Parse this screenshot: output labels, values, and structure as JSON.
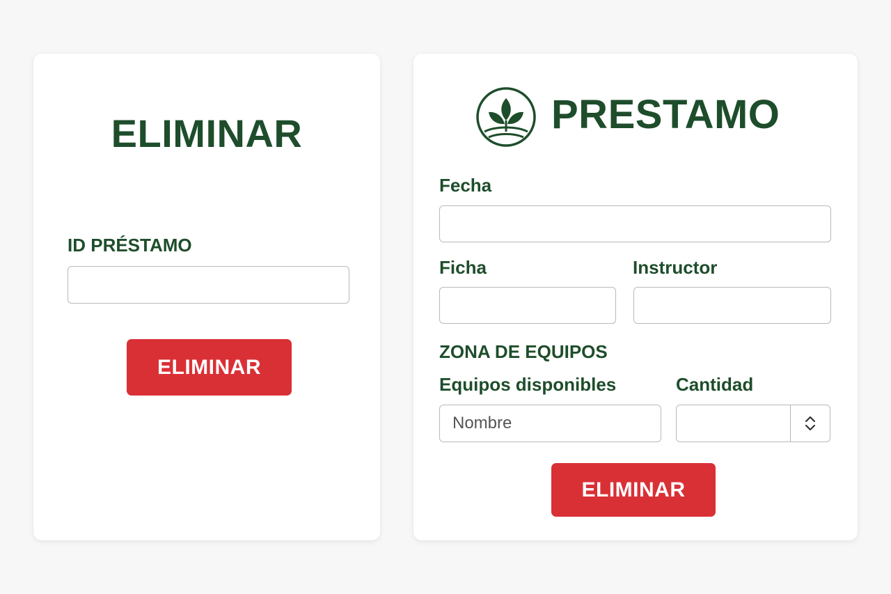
{
  "left_card": {
    "title": "ELIMINAR",
    "id_label": "ID PRÉSTAMO",
    "id_value": "",
    "delete_button": "ELIMINAR"
  },
  "right_card": {
    "title": "PRESTAMO",
    "logo_icon": "sprout-logo-icon",
    "fecha_label": "Fecha",
    "fecha_value": "",
    "ficha_label": "Ficha",
    "ficha_value": "",
    "instructor_label": "Instructor",
    "instructor_value": "",
    "zona_label": "ZONA DE EQUIPOS",
    "equipos_label": "Equipos disponibles",
    "equipos_placeholder": "Nombre",
    "cantidad_label": "Cantidad",
    "cantidad_value": "",
    "delete_button": "ELIMINAR"
  },
  "colors": {
    "brand_green": "#1e4d2b",
    "danger_red": "#d93036",
    "background": "#f7f7f7"
  }
}
